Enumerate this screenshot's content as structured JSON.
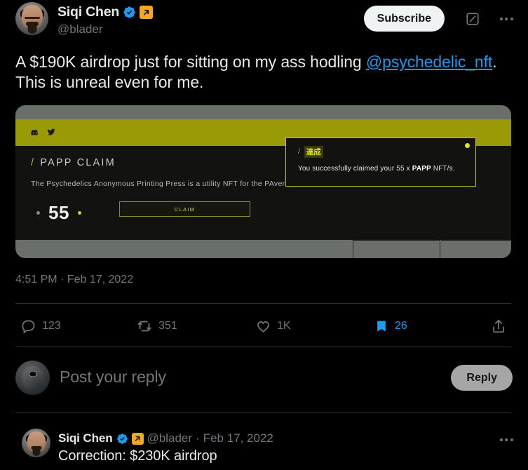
{
  "theme": {
    "background": "#000000",
    "text_primary": "#e7e9ea",
    "text_secondary": "#71767b",
    "accent_blue": "#1d9bf0",
    "affiliate_gold": "#f5a623",
    "divider": "#2f3336",
    "dapp_yellow": "#9a9a07"
  },
  "tweet": {
    "author": {
      "display_name": "Siqi Chen",
      "handle": "@blader",
      "verified_badge": "verified-check-icon",
      "affiliate_badge": "affiliate-arrow-icon",
      "avatar": "avatar-siqi-chen"
    },
    "header_actions": {
      "subscribe_label": "Subscribe",
      "grok_icon": "grok-icon",
      "more_icon": "more-options-icon"
    },
    "body": {
      "part1": "A $190K airdrop just for sitting on my ass hodling ",
      "mention": "@psychedelic_nft",
      "part2": ". This is unreal even for me."
    },
    "timestamp": "4:51 PM · Feb 17, 2022",
    "actions": [
      {
        "name": "reply",
        "icon": "reply-bubble-icon",
        "count": "123"
      },
      {
        "name": "retweet",
        "icon": "retweet-icon",
        "count": "351"
      },
      {
        "name": "like",
        "icon": "heart-icon",
        "count": "1K"
      },
      {
        "name": "bookmark",
        "icon": "bookmark-filled-icon",
        "count": "26"
      },
      {
        "name": "share",
        "icon": "share-upload-icon",
        "count": ""
      }
    ]
  },
  "media": {
    "alt": "embedded screenshot of PAPP claim dApp",
    "topbar": {
      "discord_icon": "discord-icon",
      "twitter_icon": "twitter-bird-icon"
    },
    "dapp": {
      "slash": "/",
      "title": "PAPP CLAIM",
      "description": "The Psychedelics Anonymous Printing Press is a utility NFT for the PAverse.",
      "quantity": "55",
      "claim_label": "CLAIM"
    },
    "toast": {
      "slash": "/",
      "badge": "達成",
      "message_pre": "You successfully claimed your 55 x ",
      "message_bold": "PAPP",
      "message_post": " NFT/s.",
      "close_icon": "toast-close-dot"
    }
  },
  "composer": {
    "avatar": "avatar-current-user",
    "placeholder": "Post your reply",
    "submit_label": "Reply"
  },
  "reply_tweet": {
    "author": {
      "display_name": "Siqi Chen",
      "handle": "@blader",
      "verified_badge": "verified-check-icon",
      "affiliate_badge": "affiliate-arrow-icon",
      "avatar": "avatar-siqi-chen"
    },
    "separator": "·",
    "date": "Feb 17, 2022",
    "text": "Correction: $230K airdrop",
    "more_icon": "more-options-icon"
  }
}
